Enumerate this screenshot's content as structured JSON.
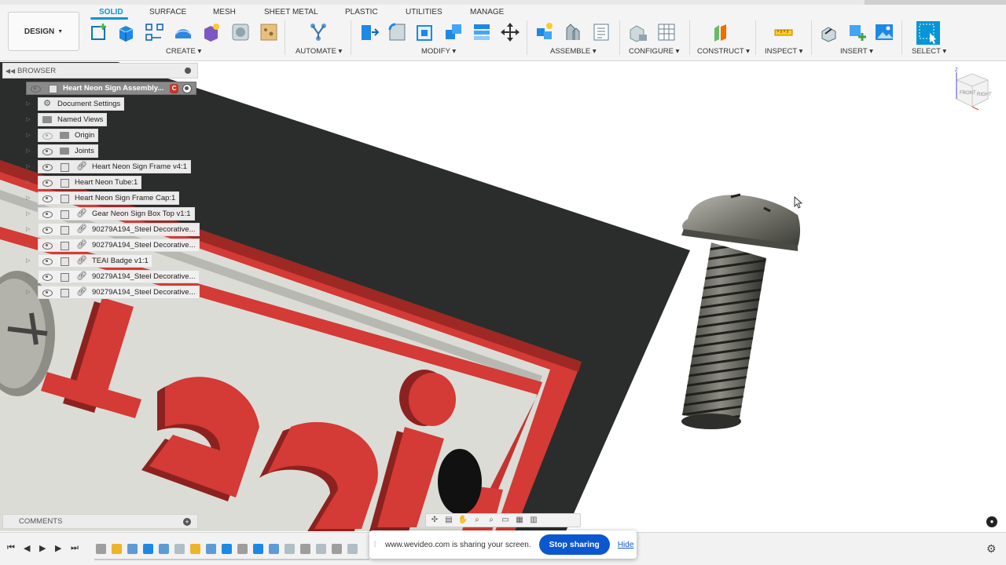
{
  "toolbar": {
    "workspace": "DESIGN",
    "tabs": [
      "SOLID",
      "SURFACE",
      "MESH",
      "SHEET METAL",
      "PLASTIC",
      "UTILITIES",
      "MANAGE"
    ],
    "active_tab": "SOLID",
    "groups": {
      "create": "CREATE",
      "automate": "AUTOMATE",
      "modify": "MODIFY",
      "assemble": "ASSEMBLE",
      "configure": "CONFIGURE",
      "construct": "CONSTRUCT",
      "inspect": "INSPECT",
      "insert": "INSERT",
      "select": "SELECT"
    },
    "accent": "#0696d7"
  },
  "browser": {
    "title": "BROWSER",
    "root": "Heart Neon Sign Assembly...",
    "items": [
      {
        "label": "Document Settings"
      },
      {
        "label": "Named Views"
      },
      {
        "label": "Origin"
      },
      {
        "label": "Joints"
      },
      {
        "label": "Heart Neon Sign Frame v4:1"
      },
      {
        "label": "Heart Neon Tube:1"
      },
      {
        "label": "Heart Neon Sign Frame Cap:1"
      },
      {
        "label": "Gear Neon Sign Box Top v1:1"
      },
      {
        "label": "90279A194_Steel Decorative..."
      },
      {
        "label": "90279A194_Steel Decorative..."
      },
      {
        "label": "TEAI Badge v1:1"
      },
      {
        "label": "90279A194_Steel Decorative..."
      },
      {
        "label": "90279A194_Steel Decorative..."
      }
    ]
  },
  "comments": {
    "title": "COMMENTS"
  },
  "viewcube": {
    "front": "FRONT",
    "right": "RIGHT",
    "axis_z": "Z"
  },
  "share_banner": {
    "message": "www.wevideo.com is sharing your screen.",
    "stop": "Stop sharing",
    "hide": "Hide"
  },
  "colors": {
    "plate": "#2c2f2d",
    "badge_red": "#d43a36",
    "badge_face": "#dcdcd6",
    "stop_button": "#0b57d0"
  }
}
